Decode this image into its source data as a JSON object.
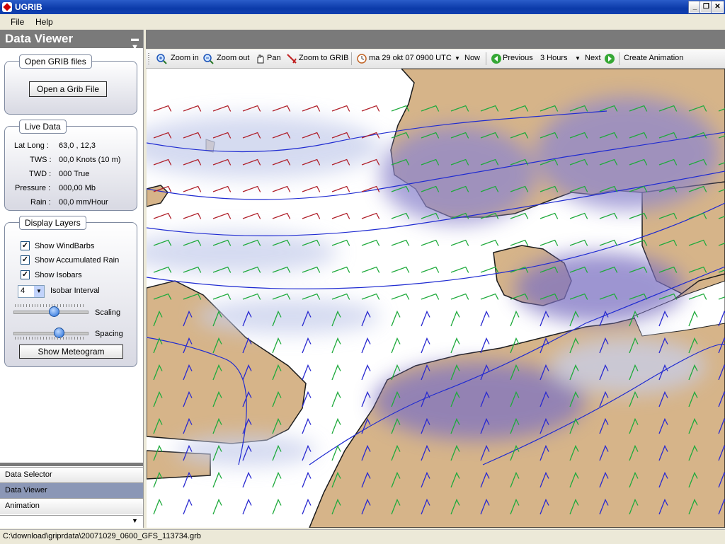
{
  "window": {
    "title": "UGRIB"
  },
  "menu": {
    "file": "File",
    "help": "Help"
  },
  "panel": {
    "title": "Data Viewer"
  },
  "open_grib": {
    "group_title": "Open GRIB files",
    "button": "Open a Grib File"
  },
  "live": {
    "group_title": "Live Data",
    "latlong_label": "Lat Long :",
    "latlong_value": "63,0 ,  12,3",
    "tws_label": "TWS :",
    "tws_value": "00,0 Knots (10 m)",
    "twd_label": "TWD :",
    "twd_value": "000 True",
    "pressure_label": "Pressure :",
    "pressure_value": "000,00 Mb",
    "rain_label": "Rain :",
    "rain_value": "00,0 mm/Hour"
  },
  "layers": {
    "group_title": "Display Layers",
    "windbarbs": "Show WindBarbs",
    "rain": "Show Accumulated Rain",
    "isobars": "Show Isobars",
    "interval_value": "4",
    "interval_label": "Isobar Interval",
    "scaling_label": "Scaling",
    "spacing_label": "Spacing",
    "meteogram_button": "Show Meteogram",
    "scaling_level": 0.55,
    "spacing_level": 0.62
  },
  "nav": {
    "data_selector": "Data Selector",
    "data_viewer": "Data Viewer",
    "animation": "Animation"
  },
  "toolbar": {
    "zoom_in": "Zoom in",
    "zoom_out": "Zoom out",
    "pan": "Pan",
    "zoom_to_grib": "Zoom to GRIB",
    "datetime": "ma 29 okt 07 0900 UTC",
    "now": "Now",
    "previous": "Previous",
    "interval": "3 Hours",
    "next": "Next",
    "create_animation": "Create Animation"
  },
  "status": {
    "path": "C:\\download\\griprdata\\20071029_0600_GFS_113734.grb"
  },
  "colors": {
    "land": "#d6b489",
    "rain_light": "#c7cfec",
    "rain_heavy": "#7d72c2",
    "isobar": "#1f2bd1",
    "barb_green": "#1faa3c",
    "barb_red": "#b0202a",
    "barb_blue": "#2a2ad0"
  }
}
